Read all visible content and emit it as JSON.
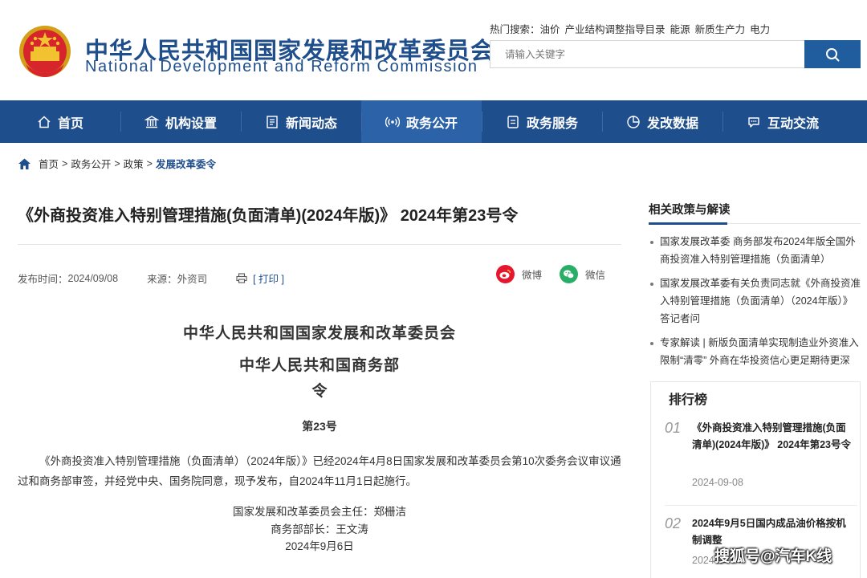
{
  "header": {
    "title_cn": "中华人民共和国国家发展和改革委员会",
    "title_en": "National Development and Reform Commission",
    "hot_label": "热门搜索：",
    "hot_terms": [
      "油价",
      "产业结构调整指导目录",
      "能源",
      "新质生产力",
      "电力"
    ],
    "search_placeholder": "请输入关键字"
  },
  "nav": {
    "items": [
      {
        "label": "首页",
        "icon": "home-icon"
      },
      {
        "label": "机构设置",
        "icon": "building-icon"
      },
      {
        "label": "新闻动态",
        "icon": "news-icon"
      },
      {
        "label": "政务公开",
        "icon": "broadcast-icon"
      },
      {
        "label": "政务服务",
        "icon": "document-icon"
      },
      {
        "label": "发改数据",
        "icon": "pie-chart-icon"
      },
      {
        "label": "互动交流",
        "icon": "chat-icon"
      }
    ],
    "active_index": 3
  },
  "breadcrumb": {
    "items": [
      "首页",
      "政务公开",
      "政策",
      "发展改革委令"
    ],
    "separator": ">"
  },
  "article": {
    "title": "《外商投资准入特别管理措施(负面清单)(2024年版)》 2024年第23号令",
    "publish_label": "发布时间：",
    "publish_date": "2024/09/08",
    "source_label": "来源：",
    "source": "外资司",
    "print_label": "[ 打印 ]",
    "share_weibo": "微博",
    "share_wechat": "微信",
    "org_line1": "中华人民共和国国家发展和改革委员会",
    "org_line2": "中华人民共和国商务部",
    "ling": "令",
    "number": "第23号",
    "paragraph": "《外商投资准入特别管理措施（负面清单）（2024年版）》已经2024年4月8日国家发展和改革委员会第10次委务会议审议通过和商务部审签，并经党中央、国务院同意，现予发布，自2024年11月1日起施行。",
    "signature1": "国家发展和改革委员会主任：郑栅洁",
    "signature2": "商务部部长：王文涛",
    "signature_date": "2024年9月6日"
  },
  "sidebar": {
    "related_title": "相关政策与解读",
    "related": [
      "国家发展改革委 商务部发布2024年版全国外商投资准入特别管理措施（负面清单）",
      "国家发展改革委有关负责同志就《外商投资准入特别管理措施（负面清单）（2024年版）》答记者问",
      "专家解读 | 新版负面清单实现制造业外资准入限制“清零” 外商在华投资信心更足期待更深"
    ],
    "ranking_title": "排行榜",
    "ranking": [
      {
        "no": "01",
        "title": "《外商投资准入特别管理措施(负面清单)(2024年版)》 2024年第23号令",
        "date": "2024-09-08"
      },
      {
        "no": "02",
        "title": "2024年9月5日国内成品油价格按机制调整",
        "date": "2024-0"
      }
    ]
  },
  "watermark": "搜狐号@汽车K线",
  "colors": {
    "primary": "#1f4e8c",
    "nav_active": "#2c62a8",
    "weibo": "#e6162d",
    "wechat": "#2aae67"
  }
}
